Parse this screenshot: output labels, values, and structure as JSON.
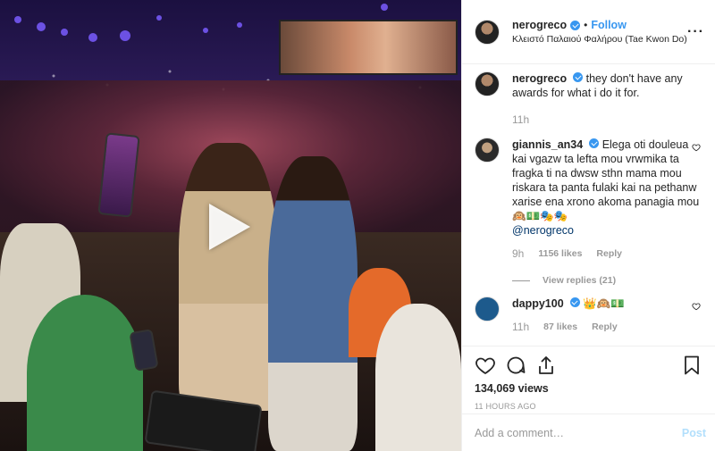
{
  "header": {
    "username": "nerogreco",
    "separator": "•",
    "follow_label": "Follow",
    "location": "Κλειστό Παλαιού Φαλήρου (Tae Kwon Do)",
    "more_label": "···"
  },
  "caption": {
    "username": "nerogreco",
    "text": "they don't have any awards for what i do it for.",
    "time": "11h"
  },
  "comments": [
    {
      "username": "giannis_an34",
      "text": "Elega oti douleua kai vgazw ta lefta mou vrwmika ta fragka ti na dwsw sthn mama mou riskara ta panta fulaki kai na pethanw xarise ena xrono akoma panagia mou 🙉💵🎭🎭",
      "mention": "@nerogreco",
      "time": "9h",
      "likes": "1156 likes",
      "reply_label": "Reply",
      "view_replies": "View replies (21)"
    },
    {
      "username": "dappy100",
      "text": "👑🙉💵",
      "time": "11h",
      "likes": "87 likes",
      "reply_label": "Reply"
    }
  ],
  "stats": {
    "views": "134,069 views",
    "ago": "11 HOURS AGO"
  },
  "add_comment": {
    "placeholder": "Add a comment…",
    "post_label": "Post"
  },
  "icons": {
    "verified": "verified-badge-icon",
    "heart": "heart-icon",
    "comment": "comment-icon",
    "share": "share-icon",
    "bookmark": "bookmark-icon",
    "play": "play-icon"
  },
  "colors": {
    "accent": "#3897f0",
    "muted": "#999999",
    "post_disabled": "#b2dffc",
    "mention": "#003569"
  }
}
